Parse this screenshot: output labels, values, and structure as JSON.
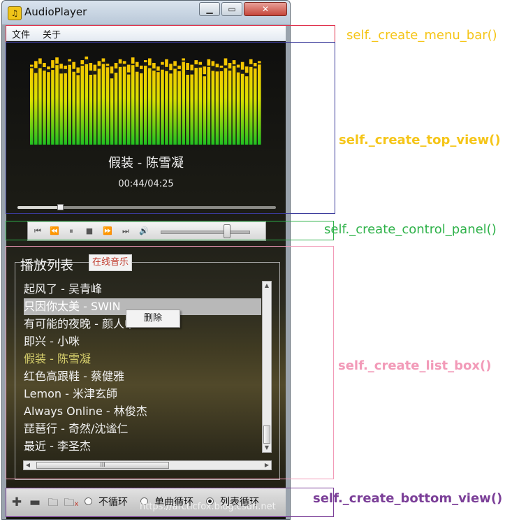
{
  "window": {
    "title": "AudioPlayer",
    "app_icon": "music-note-icon"
  },
  "menu": {
    "items": [
      "文件",
      "关于"
    ]
  },
  "now_playing": {
    "title": "假装 - 陈雪凝",
    "time": "00:44/04:25",
    "progress": 0.166
  },
  "spectrum": {
    "levels": [
      0.88,
      0.92,
      0.95,
      0.9,
      0.86,
      0.93,
      0.96,
      0.89,
      0.87,
      0.94,
      0.91,
      0.85,
      0.93,
      0.97,
      0.9,
      0.88,
      0.92,
      0.95,
      0.89,
      0.86,
      0.9,
      0.94,
      0.92,
      0.88,
      0.96,
      0.91,
      0.87,
      0.93,
      0.95,
      0.9,
      0.86,
      0.91,
      0.94,
      0.89,
      0.92,
      0.87,
      0.95,
      0.9,
      0.88,
      0.93,
      0.91,
      0.86,
      0.94,
      0.92,
      0.89,
      0.87,
      0.95,
      0.9,
      0.93,
      0.88,
      0.91,
      0.86,
      0.94,
      0.9,
      0.92
    ],
    "colors": {
      "top": "#f7c400",
      "mid": "#d8e000",
      "bottom": "#20c020",
      "peak": "#1a1a1a"
    }
  },
  "controls": {
    "buttons": [
      "skip-start-icon",
      "rewind-icon",
      "pause-icon",
      "stop-icon",
      "fast-forward-icon",
      "skip-end-icon",
      "volume-icon"
    ],
    "volume": 0.75
  },
  "playlist": {
    "title": "播放列表",
    "online_button": "在线音乐",
    "items": [
      {
        "text": "起风了 - 吴青峰",
        "state": "normal"
      },
      {
        "text": "只因你太美 - SWIN",
        "state": "selected"
      },
      {
        "text": "有可能的夜晚 - 颜人中",
        "state": "normal"
      },
      {
        "text": "即兴 - 小咪",
        "state": "normal"
      },
      {
        "text": "假装 - 陈雪凝",
        "state": "playing"
      },
      {
        "text": "红色高跟鞋 - 蔡健雅",
        "state": "normal"
      },
      {
        "text": "Lemon - 米津玄師",
        "state": "normal"
      },
      {
        "text": "Always Online - 林俊杰",
        "state": "normal"
      },
      {
        "text": "琵琶行 - 奇然/沈谧仁",
        "state": "normal"
      },
      {
        "text": "最近 - 李圣杰",
        "state": "normal"
      }
    ],
    "context_menu": {
      "delete_label": "删除"
    }
  },
  "bottom": {
    "buttons": [
      "add-icon",
      "remove-icon",
      "folder-icon",
      "clear-list-icon"
    ],
    "loop_modes": [
      {
        "label": "不循环",
        "checked": false
      },
      {
        "label": "单曲循环",
        "checked": false
      },
      {
        "label": "列表循环",
        "checked": true
      }
    ],
    "watermark": "https://arcticfox.blog.csdn.net"
  },
  "annotations": [
    {
      "text": "self._create_menu_bar()",
      "color": "#f5c518"
    },
    {
      "text": "self._create_top_view()",
      "color": "#f5c518"
    },
    {
      "text": "self._create_control_panel()",
      "color": "#2fb24a"
    },
    {
      "text": "self._create_list_box()",
      "color": "#f29ab8"
    },
    {
      "text": "self._create_bottom_view()",
      "color": "#7b3f98"
    }
  ],
  "colors": {
    "menu_box": "#e0324d",
    "top_box": "#3a3a9a",
    "control_box": "#2fb24a",
    "list_box": "#f29ab8",
    "bottom_box": "#7b3f98"
  }
}
